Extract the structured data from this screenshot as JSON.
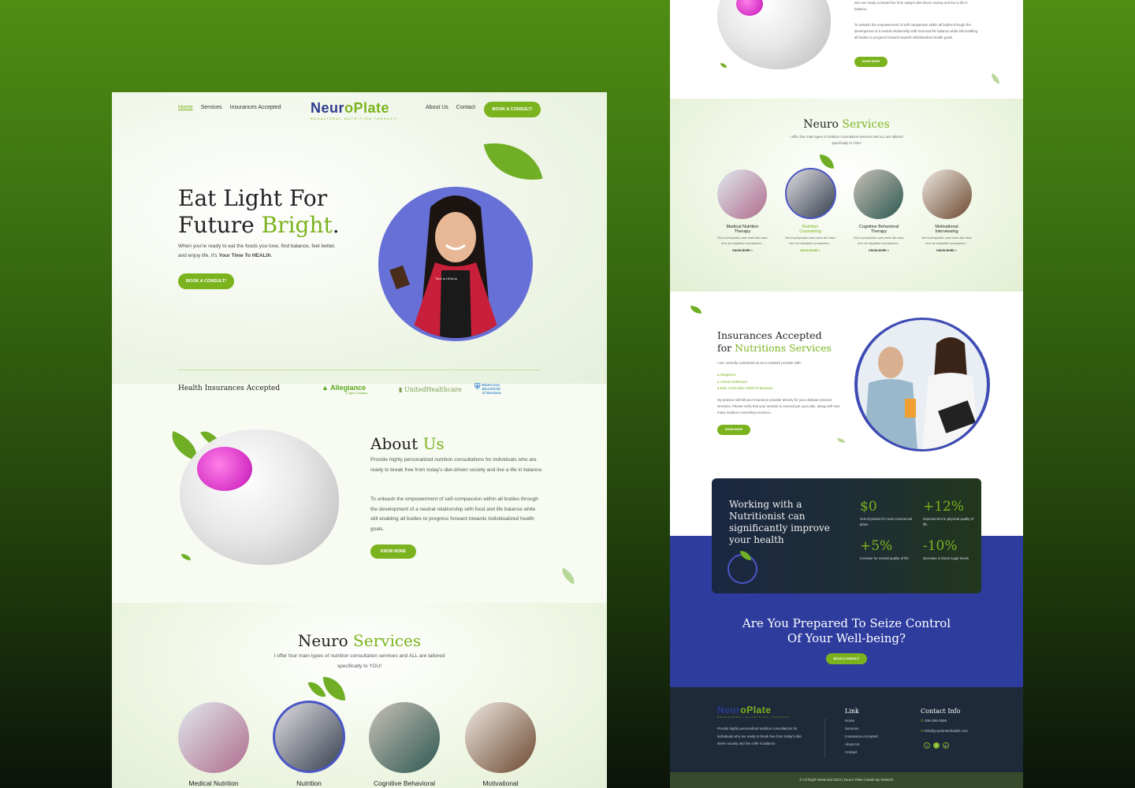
{
  "left": {
    "nav": {
      "home": "Home",
      "services": "Services",
      "insurances": "Insurances Accepted",
      "about": "About Us",
      "contact": "Contact",
      "cta": "BOOK A CONSULT!"
    },
    "logo": {
      "neuro": "Neur",
      "o": "o",
      "plate": "Plate",
      "tagline": "BEHAVIORAL NUTRITION THERAPY"
    },
    "hero": {
      "line1": "Eat Light For",
      "line2_a": "Future ",
      "line2_b": "Bright",
      "line2_c": ".",
      "paragraph_a": "When you're ready to eat the foods you love, find balance, feel better, and enjoy life, it's ",
      "paragraph_b": "Your Time To HEALth",
      "paragraph_c": ".",
      "button": "BOOK A CONSULT!",
      "apron": "Time to HEALth"
    },
    "insurance": {
      "label": "Health Insurances Accepted",
      "allegiance": "Allegiance",
      "allegiance_sub": "A Cigna Company",
      "united": "UnitedHealthcare",
      "bcbs_a": "BlueCross BlueShield",
      "bcbs_b": "of Montana"
    },
    "about": {
      "title_a": "About ",
      "title_b": "Us",
      "p1": "Provide highly personalized nutrition consultations for individuals who are ready to break free from today's diet-driven society and live a life in balance.",
      "p2": "To unleash the empowerment of self-compassion within all bodies through the development of a neutral relationship with food and life balance while still enabling all bodies to progress forward towards individualized health goals.",
      "button": "KNOW MORE"
    },
    "services": {
      "title_a": "Neuro ",
      "title_b": "Services",
      "subtitle": "I offer four main types of nutrition consultation services and ALL are tailored specifically to YOU!",
      "items": [
        "Medical Nutrition",
        "Nutrition",
        "Cognitive Behavioral",
        "Motivational"
      ]
    }
  },
  "right": {
    "top": {
      "p1": "who are ready to break free from today's diet-driven society and live a life in balance.",
      "p2": "To unleash the empowerment of self-compassion within all bodies through the development of a neutral relationship with food and life balance while still enabling all bodies to progress forward towards individualized health goals.",
      "button": "KNOW MORE"
    },
    "services": {
      "title_a": "Neuro ",
      "title_b": "Services",
      "subtitle": "I offer four main types of nutrition consultation services and ALL are tailored specifically to YOU!",
      "items": [
        {
          "l1": "Medical Nutrition",
          "l2": "Therapy",
          "desc": "Sed ut perspiciatis unde omnis iste natus error sit voluptatem accusantium...",
          "link": "KNOW MORE >"
        },
        {
          "l1": "Nutrition",
          "l2": "Counseling",
          "desc": "Sed ut perspiciatis unde omnis iste natus error sit voluptatem accusantium...",
          "link": "KNOW MORE >"
        },
        {
          "l1": "Cognitive Behavioral",
          "l2": "Therapy",
          "desc": "Sed ut perspiciatis unde omnis iste natus error sit voluptatem accusantium...",
          "link": "KNOW MORE >"
        },
        {
          "l1": "Motivational",
          "l2": "Interviewing",
          "desc": "Sed ut perspiciatis unde omnis iste natus error sit voluptatem accusantium...",
          "link": "KNOW MORE >"
        }
      ]
    },
    "insurance": {
      "title_l1": "Insurances Accepted",
      "title_l2_a": "for ",
      "title_l2_b": "Nutritions Services",
      "intro": "I am currently contracted as an in-network provider with:",
      "list": [
        "Allegiance",
        "United Healthcare",
        "Blue Cross Blue Shield of Montana"
      ],
      "body": "My practice will bill your insurance provider directly for your dietitian services sessions. Please verify that your session is covered per your plan, along with how many nutrition counseling sessions...",
      "button": "KNOW MORE"
    },
    "stats": {
      "heading": "Working with a Nutritionist can significantly improve your health",
      "items": [
        {
          "value": "$0",
          "label": "Out-of-pocket for most commercial plans"
        },
        {
          "value": "+12%",
          "label": "improvement in physical quality of life"
        },
        {
          "value": "+5%",
          "label": "Increase for mental quality of life"
        },
        {
          "value": "-10%",
          "label": "decrease in blood sugar levels"
        }
      ]
    },
    "cta": {
      "line1": "Are You Prepared To Seize Control",
      "line2": "Of Your Well-being?",
      "button": "BOOK A CONSULT!"
    },
    "footer": {
      "about": "Provide highly personalized nutrition consultations for individuals who are ready to break free from today's diet-driven society and live a life in balance.",
      "link_title": "Link",
      "links": [
        "Home",
        "Services",
        "Insurances Accepted",
        "About Us",
        "Contact"
      ],
      "contact_title": "Contact Info",
      "phone": "406-290-3086",
      "email": "info@yourtimetohealth.com",
      "social": [
        "f",
        "◎",
        "in"
      ],
      "copyright": "© All Right Reserved 2023 | Neuro Plate | Made By Weitech"
    }
  },
  "colors": {
    "green": "#7bb31e",
    "navy": "#2d3a8c",
    "blue_band": "#2e3c9e",
    "footer": "#1e2a3a"
  }
}
